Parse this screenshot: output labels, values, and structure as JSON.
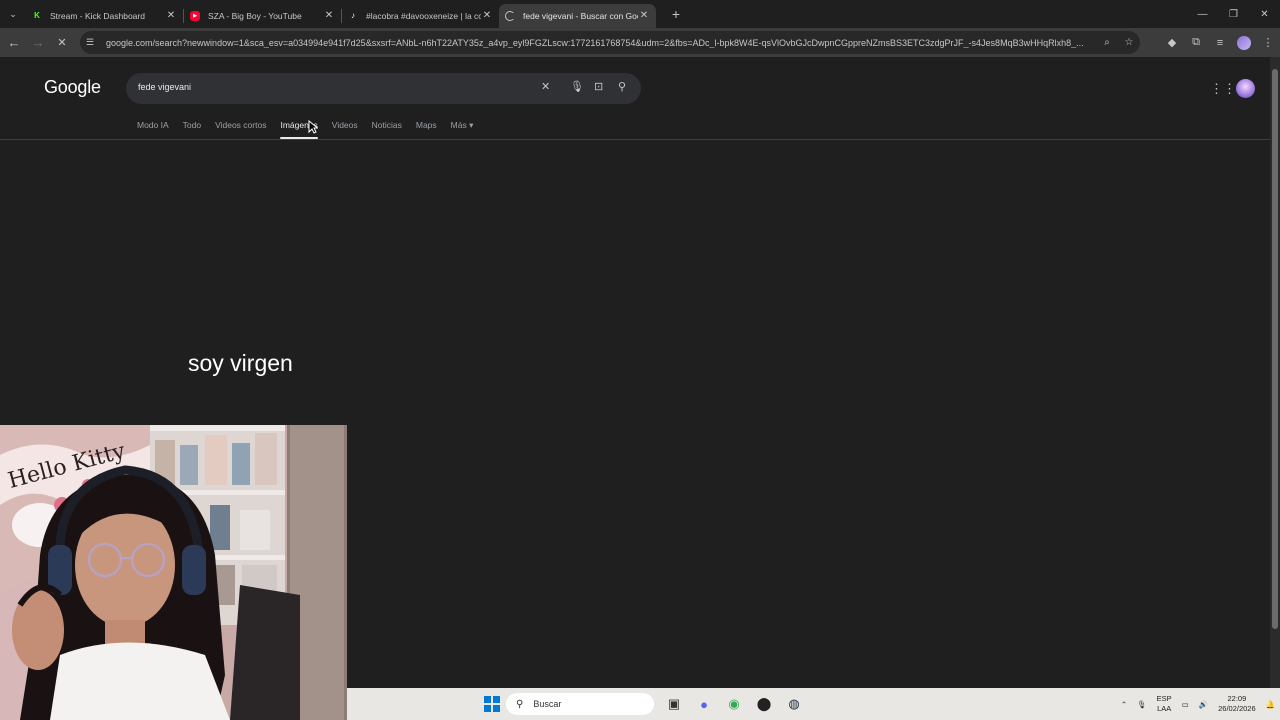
{
  "browser": {
    "tabs": [
      {
        "title": "Stream - Kick Dashboard",
        "favicon": "kick-icon",
        "favicon_color": "#53fc18",
        "active": false
      },
      {
        "title": "SZA - Big Boy - YouTube",
        "favicon": "youtube-icon",
        "favicon_color": "#ff0033",
        "active": false
      },
      {
        "title": "#lacobra #davooxeneize | la co",
        "favicon": "tiktok-icon",
        "favicon_color": "#ffffff",
        "active": false
      },
      {
        "title": "fede vigevani - Buscar con Goo",
        "favicon": "loading-icon",
        "favicon_color": "#c7c7c7",
        "active": true
      }
    ],
    "url": "google.com/search?newwindow=1&sca_esv=a034994e941f7d25&sxsrf=ANbL-n6hT22ATY35z_a4vp_eyl9FGZLscw:1772161768754&udm=2&fbs=ADc_l-bpk8W4E-qsVlOvbGJcDwpnCGppreNZmsBS3ETC3zdgPrJF_-s4Jes8MqB3wHHqRlxh8_..."
  },
  "google": {
    "logo": "Google",
    "query": "fede vigevani",
    "filters": [
      "Modo IA",
      "Todo",
      "Videos cortos",
      "Imágenes",
      "Videos",
      "Noticias",
      "Maps",
      "Más"
    ],
    "selected_filter": "Imágenes"
  },
  "overlay": {
    "caption": "soy virgen"
  },
  "taskbar": {
    "search_placeholder": "Buscar",
    "lang_top": "ESP",
    "lang_bottom": "LAA",
    "time": "22:09",
    "date": "26/02/2026"
  }
}
